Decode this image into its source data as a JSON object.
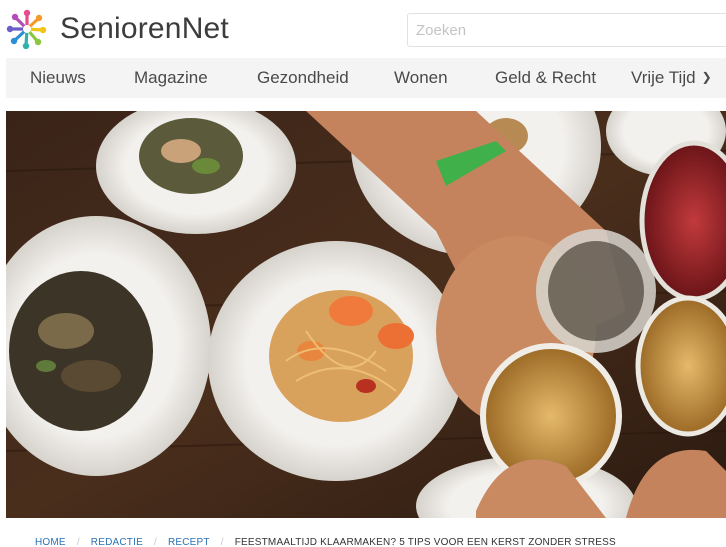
{
  "site": {
    "name": "SeniorenNet"
  },
  "search": {
    "placeholder": "Zoeken"
  },
  "nav": {
    "items": [
      {
        "label": "Nieuws"
      },
      {
        "label": "Magazine"
      },
      {
        "label": "Gezondheid"
      },
      {
        "label": "Wonen"
      },
      {
        "label": "Geld & Recht"
      },
      {
        "label": "Vrije Tijd"
      }
    ]
  },
  "breadcrumb": {
    "items": [
      "HOME",
      "REDACTIE",
      "RECEPT"
    ],
    "separator": "/",
    "current": "FEESTMAALTIJD KLAARMAKEN? 5 TIPS VOOR EEN KERST ZONDER STRESS"
  },
  "colors": {
    "link": "#2a72b5",
    "nav_bg": "#f4f4f4",
    "text": "#4a4a4a"
  },
  "icons": {
    "logo": "seniorennet-logo-icon",
    "nav_more": "chevron-down-icon"
  }
}
